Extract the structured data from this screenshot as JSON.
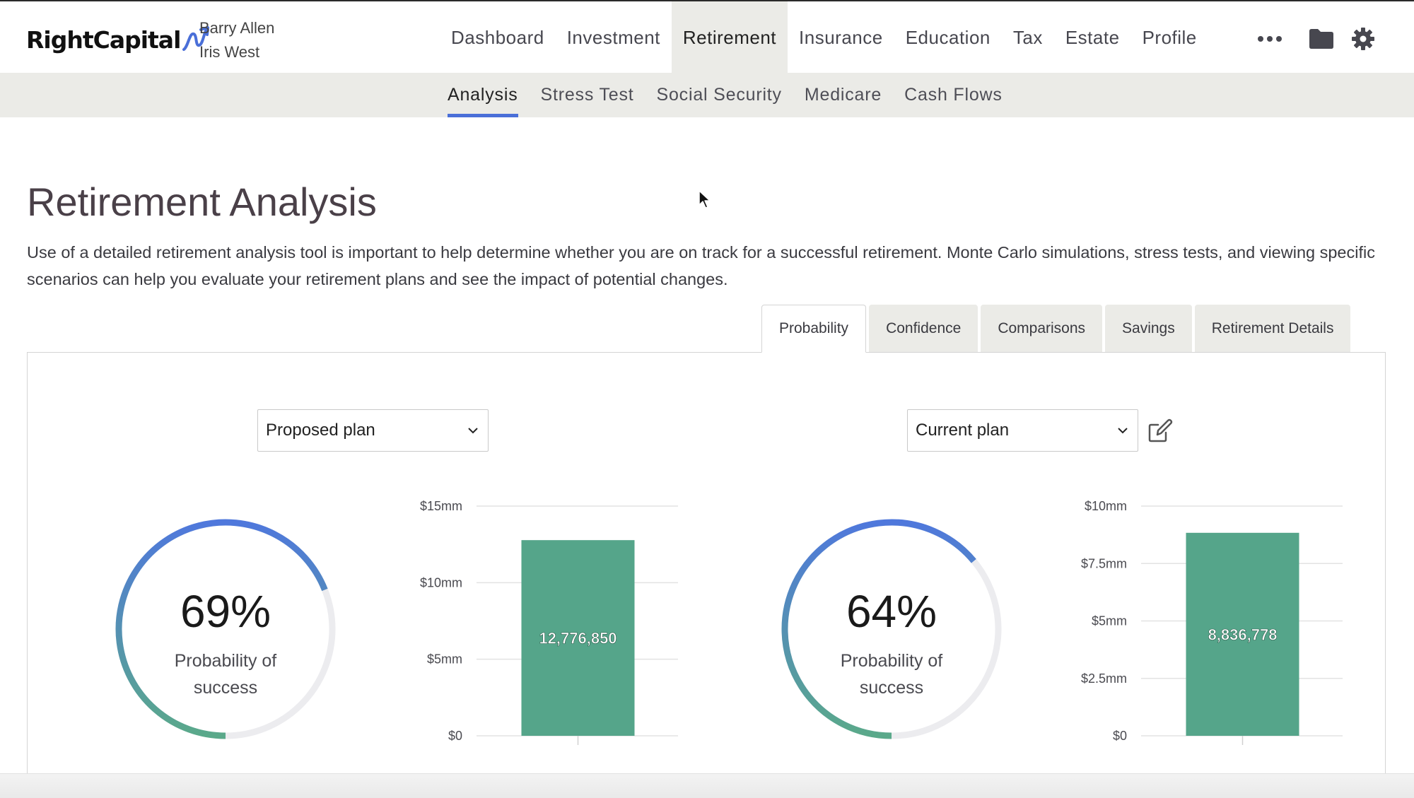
{
  "brand": {
    "name": "RightCapital"
  },
  "clients": [
    "Barry Allen",
    "Iris West"
  ],
  "main_nav": [
    {
      "label": "Dashboard",
      "active": false
    },
    {
      "label": "Investment",
      "active": false
    },
    {
      "label": "Retirement",
      "active": true
    },
    {
      "label": "Insurance",
      "active": false
    },
    {
      "label": "Education",
      "active": false
    },
    {
      "label": "Tax",
      "active": false
    },
    {
      "label": "Estate",
      "active": false
    },
    {
      "label": "Profile",
      "active": false
    }
  ],
  "top_icons": [
    "more-icon",
    "folder-icon",
    "gear-icon"
  ],
  "sub_nav": [
    {
      "label": "Analysis",
      "active": true
    },
    {
      "label": "Stress Test",
      "active": false
    },
    {
      "label": "Social Security",
      "active": false
    },
    {
      "label": "Medicare",
      "active": false
    },
    {
      "label": "Cash Flows",
      "active": false
    }
  ],
  "page": {
    "title": "Retirement Analysis",
    "description": "Use of a detailed retirement analysis tool is important to help determine whether you are on track for a successful retirement. Monte Carlo simulations, stress tests, and viewing specific scenarios can help you evaluate your retirement plans and see the impact of potential changes."
  },
  "tabs": [
    {
      "label": "Probability",
      "active": true
    },
    {
      "label": "Confidence",
      "active": false
    },
    {
      "label": "Comparisons",
      "active": false
    },
    {
      "label": "Savings",
      "active": false
    },
    {
      "label": "Retirement Details",
      "active": false
    }
  ],
  "plans": [
    {
      "select_label": "Proposed plan",
      "probability_text": "69%",
      "probability": 0.69,
      "label": "Probability of success",
      "label_lines": [
        "Probability of",
        "success"
      ]
    },
    {
      "select_label": "Current plan",
      "probability_text": "64%",
      "probability": 0.64,
      "label": "Probability of success",
      "label_lines": [
        "Probability of",
        "success"
      ]
    }
  ],
  "colors": {
    "bar": "#55a58a",
    "accent": "#4a6fd8",
    "arc_start": "#4f78dc",
    "arc_end": "#5aa98a",
    "track": "#ececef"
  },
  "chart_data": [
    {
      "type": "bar",
      "categories": [
        ""
      ],
      "values": [
        12776850
      ],
      "data_labels": [
        "12,776,850"
      ],
      "yticks": [
        0,
        5000000,
        10000000,
        15000000
      ],
      "ytick_labels": [
        "$0",
        "$5mm",
        "$10mm",
        "$15mm"
      ],
      "ylim": [
        0,
        15000000
      ],
      "grid": true
    },
    {
      "type": "bar",
      "categories": [
        ""
      ],
      "values": [
        8836778
      ],
      "data_labels": [
        "8,836,778"
      ],
      "yticks": [
        0,
        2500000,
        5000000,
        7500000,
        10000000
      ],
      "ytick_labels": [
        "$0",
        "$2.5mm",
        "$5mm",
        "$7.5mm",
        "$10mm"
      ],
      "ylim": [
        0,
        10000000
      ],
      "grid": true
    }
  ]
}
